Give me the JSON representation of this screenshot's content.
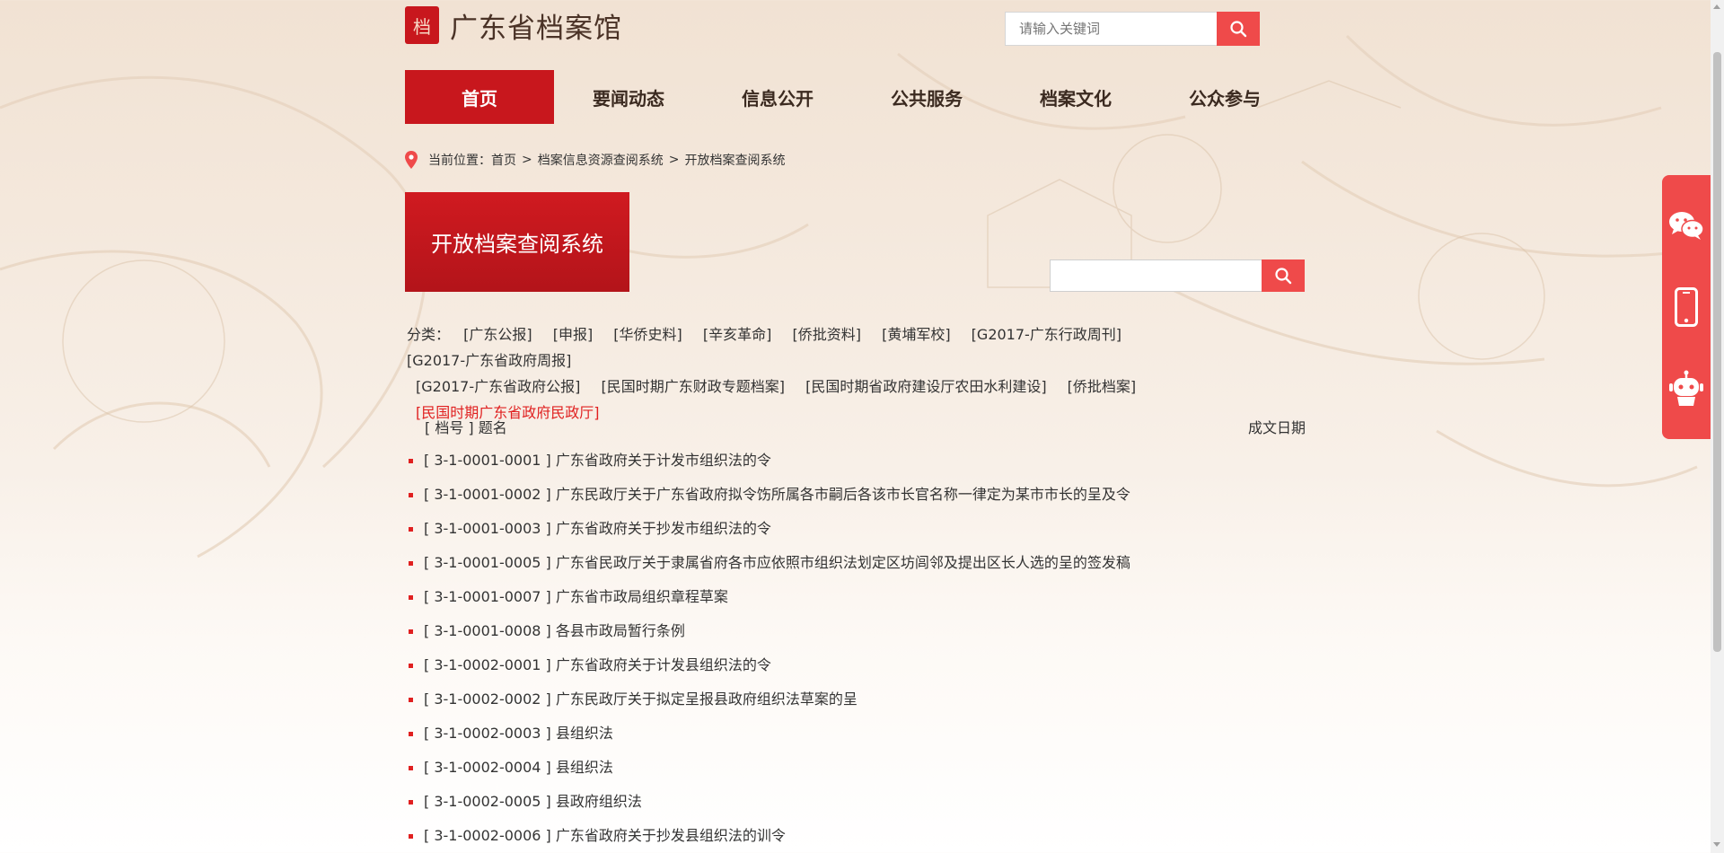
{
  "header": {
    "site_name": "广东省档案馆",
    "seal_text": "档",
    "search_placeholder": "请输入关键词"
  },
  "nav": [
    {
      "label": "首页",
      "active": true
    },
    {
      "label": "要闻动态"
    },
    {
      "label": "信息公开"
    },
    {
      "label": "公共服务"
    },
    {
      "label": "档案文化"
    },
    {
      "label": "公众参与"
    }
  ],
  "breadcrumb": {
    "prefix": "当前位置：",
    "items": [
      "首页",
      "档案信息资源查阅系统",
      "开放档案查阅系统"
    ],
    "separator": ">"
  },
  "page_title": "开放档案查阅系统",
  "categories": {
    "label": "分类：",
    "rows": [
      [
        "[广东公报]",
        "[申报]",
        "[华侨史料]",
        "[辛亥革命]",
        "[侨批资料]",
        "[黄埔军校]",
        "[G2017-广东行政周刊]",
        "[G2017-广东省政府周报]"
      ],
      [
        "[G2017-广东省政府公报]",
        "[民国时期广东财政专题档案]",
        "[民国时期省政府建设厅农田水利建设]",
        "[侨批档案]"
      ],
      [
        "[民国时期广东省政府民政厅]"
      ]
    ],
    "active": "[民国时期广东省政府民政厅]"
  },
  "list_header": {
    "left": "[ 档号 ] 题名",
    "right": "成文日期"
  },
  "records": [
    "[ 3-1-0001-0001 ] 广东省政府关于计发市组织法的令",
    "[ 3-1-0001-0002 ] 广东民政厅关于广东省政府拟令饬所属各市嗣后各该市长官名称一律定为某市市长的呈及令",
    "[ 3-1-0001-0003 ] 广东省政府关于抄发市组织法的令",
    "[ 3-1-0001-0005 ] 广东省民政厅关于隶属省府各市应依照市组织法划定区坊闾邻及提出区长人选的呈的签发稿",
    "[ 3-1-0001-0007 ] 广东省市政局组织章程草案",
    "[ 3-1-0001-0008 ] 各县市政局暂行条例",
    "[ 3-1-0002-0001 ] 广东省政府关于计发县组织法的令",
    "[ 3-1-0002-0002 ] 广东民政厅关于拟定呈报县政府组织法草案的呈",
    "[ 3-1-0002-0003 ] 县组织法",
    "[ 3-1-0002-0004 ] 县组织法",
    "[ 3-1-0002-0005 ] 县政府组织法",
    "[ 3-1-0002-0006 ] 广东省政府关于抄发县组织法的训令"
  ],
  "side_float": [
    "wechat-icon",
    "mobile-icon",
    "robot-icon"
  ],
  "colors": {
    "brand_red": "#c8171d",
    "accent_red": "#ef4a4a",
    "link_active": "#e02020"
  }
}
